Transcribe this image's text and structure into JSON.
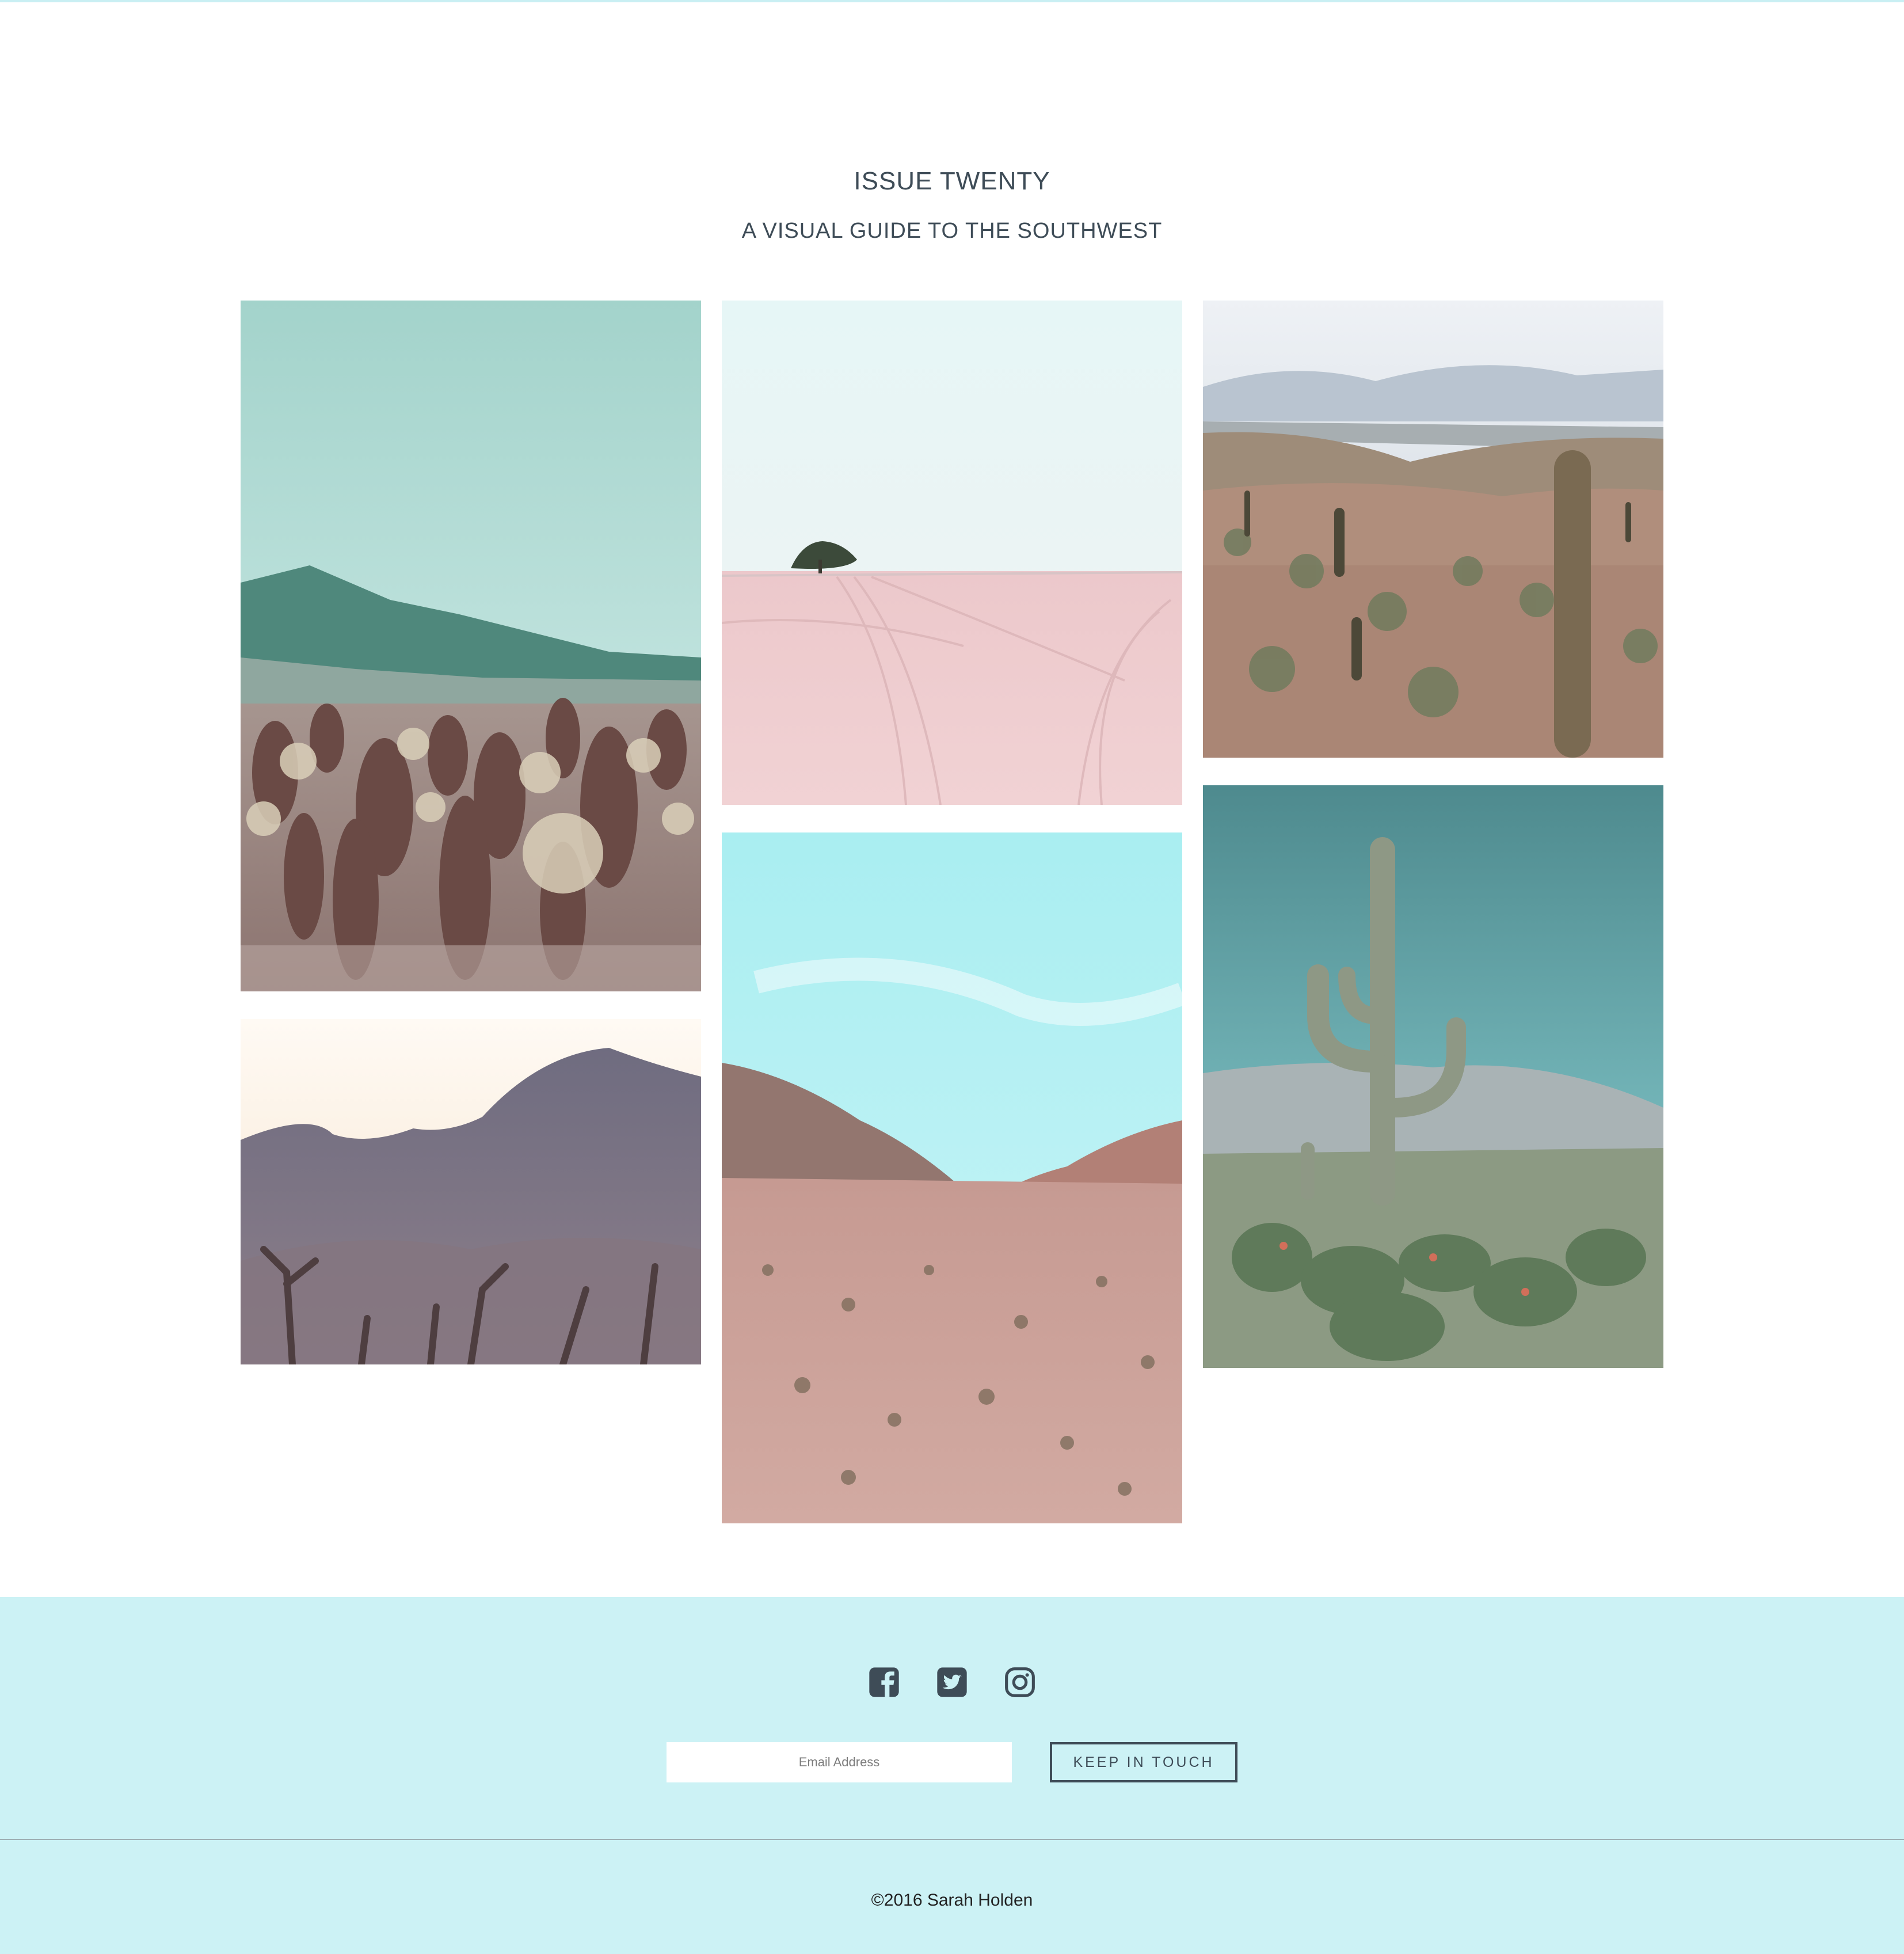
{
  "header": {
    "title": "ISSUE TWENTY",
    "subtitle": "A VISUAL GUIDE TO THE SOUTHWEST"
  },
  "gallery": [
    {
      "subject": "cholla cactus garden with mountains"
    },
    {
      "subject": "lone tree on pink desert flat"
    },
    {
      "subject": "saguaro valley overlook"
    },
    {
      "subject": "blurred cactus silhouette at dusk"
    },
    {
      "subject": "pink desert valley under sky"
    },
    {
      "subject": "tall saguaro with prickly pear"
    }
  ],
  "footer": {
    "social": [
      {
        "name": "facebook-icon"
      },
      {
        "name": "twitter-icon"
      },
      {
        "name": "instagram-icon"
      }
    ],
    "email_placeholder": "Email Address",
    "button_label": "KEEP IN TOUCH",
    "copyright": "©2016 Sarah Holden"
  },
  "colors": {
    "heading": "#3e4c57",
    "footer_bg": "#ccf2f5",
    "top_rule": "#c9eff3"
  }
}
